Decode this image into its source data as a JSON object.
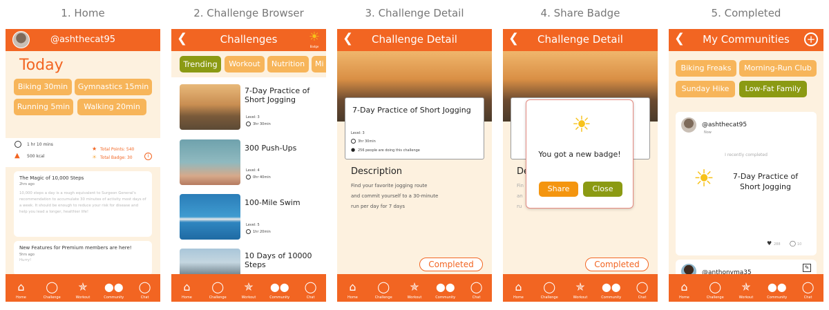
{
  "captions": [
    "1. Home",
    "2. Challenge Browser",
    "3. Challenge Detail",
    "4. Share Badge",
    "5. Completed"
  ],
  "nav": [
    {
      "label": "Home",
      "icon": "home-icon"
    },
    {
      "label": "Challenge",
      "icon": "trophy-icon"
    },
    {
      "label": "Workout",
      "icon": "runner-icon"
    },
    {
      "label": "Community",
      "icon": "community-icon"
    },
    {
      "label": "Chat",
      "icon": "chat-icon"
    }
  ],
  "home": {
    "username": "@ashthecat95",
    "today": "Today",
    "activities": [
      "Biking 30min",
      "Gymnastics 15min",
      "Running 5min",
      "Walking 20min"
    ],
    "duration": "1 hr 10 mins",
    "calories": "500 kcal",
    "total_points": "Total Points: 540",
    "total_badge": "Total Badge: 30",
    "posts": [
      {
        "title": "The Magic of 10,000 Steps",
        "time": "2hrs ago",
        "body": "10,000 steps a day is a rough equivalent to Surgeon General's recommendation to accumulate 30 minutes of activity most days of a week. It should be enough to reduce your risk for disease and help you lead a longer, healthier life!"
      },
      {
        "title": "New Features for Premium members are here!",
        "time": "5hrs ago",
        "body": "Hurry!"
      }
    ]
  },
  "browser": {
    "title": "Challenges",
    "badge_label": "Badge",
    "tabs": [
      "Trending",
      "Workout",
      "Nutrition",
      "Mi"
    ],
    "items": [
      {
        "title": "7-Day Practice of Short Jogging",
        "level": "Level: 3",
        "time": "3hr 30min"
      },
      {
        "title": "300 Push-Ups",
        "level": "Level: 4",
        "time": "0hr 40min"
      },
      {
        "title": "100-Mile Swim",
        "level": "Level: 5",
        "time": "1hr 20min"
      },
      {
        "title": "10 Days of 10000 Steps",
        "level": "",
        "time": ""
      }
    ]
  },
  "detail": {
    "title": "Challenge Detail",
    "card_title": "7-Day Practice of Short Jogging",
    "level": "Level: 3",
    "time": "3hr 30min",
    "people": "256 people are doing this challenge",
    "desc_heading": "Description",
    "desc_lines": [
      "Find your favorite jogging route",
      "and commit yourself to a 30-minute",
      "run per day for 7 days"
    ],
    "completed": "Completed"
  },
  "share": {
    "title": "Challenge Detail",
    "message": "You got a new badge!",
    "share_btn": "Share",
    "close_btn": "Close",
    "partial_desc": "De",
    "partial_lines": [
      "Fin",
      "an",
      "ru"
    ],
    "completed": "Completed"
  },
  "completed": {
    "title": "My Communities",
    "tags": [
      "Biking Freaks",
      "Morning-Run Club",
      "Sunday Hike",
      "Low-Fat Family"
    ],
    "post_user": "@ashthecat95",
    "post_time": "Now",
    "recently": "I recently completed",
    "challenge": "7-Day Practice of Short Jogging",
    "likes": "288",
    "comments": "10",
    "next_user": "@anthonyma35"
  },
  "colors": {
    "orange": "#f26522",
    "tag": "#f7b55a",
    "olive": "#8b9a13",
    "cream": "#fdf1df"
  }
}
